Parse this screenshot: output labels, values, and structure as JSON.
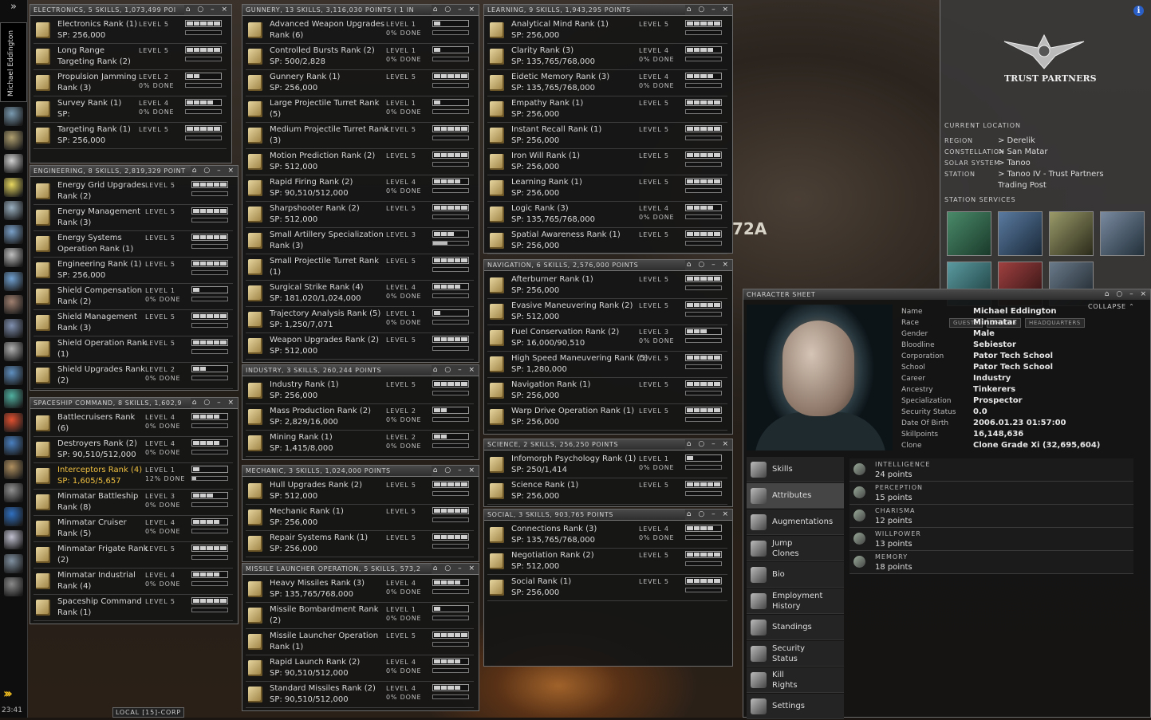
{
  "neocom": {
    "expand_label": "»",
    "character_name": "Michael Eddington",
    "clock": "23:41",
    "icons": [
      "portrait-icon",
      "character-icon",
      "mail-icon",
      "notepad-icon",
      "map-icon",
      "inventory-icon",
      "market-icon",
      "corp-icon",
      "fitting-icon",
      "science-icon",
      "assets-icon",
      "contracts-icon",
      "wallet-icon",
      "help-icon",
      "browser-icon",
      "journal-icon",
      "chat-icon",
      "info-icon",
      "agent-icon",
      "ship-icon",
      "drone-icon"
    ]
  },
  "background": {
    "hangar_text": "72A"
  },
  "windows": [
    {
      "id": "electronics",
      "title": "ELECTRONICS, 5 SKILLS, 1,073,499 POI",
      "controls": "⌂ ○ – ×",
      "skills": [
        {
          "n1": "Electronics Rank (1)",
          "n2": "SP: 256,000",
          "level": "LEVEL 5",
          "done": "",
          "lvl": 5,
          "train": 0
        },
        {
          "n1": "Long Range",
          "n2": "Targeting Rank (2)",
          "level": "LEVEL 5",
          "done": "",
          "lvl": 5,
          "train": 0
        },
        {
          "n1": "Propulsion Jamming",
          "n2": "Rank (3)",
          "level": "LEVEL 2",
          "done": "0% DONE",
          "lvl": 2,
          "train": 0
        },
        {
          "n1": "Survey Rank (1)",
          "n2": "SP:",
          "level": "LEVEL 4",
          "done": "0% DONE",
          "lvl": 4,
          "train": 0
        },
        {
          "n1": "Targeting Rank (1)",
          "n2": "SP: 256,000",
          "level": "LEVEL 5",
          "done": "",
          "lvl": 5,
          "train": 0
        }
      ]
    },
    {
      "id": "engineering",
      "title": "ENGINEERING, 8 SKILLS, 2,819,329 POINT",
      "controls": "⌂ ○ – ×",
      "skills": [
        {
          "n1": "Energy Grid Upgrades",
          "n2": "Rank (2)",
          "level": "LEVEL 5",
          "done": "",
          "lvl": 5,
          "train": 0
        },
        {
          "n1": "Energy Management",
          "n2": "Rank (3)",
          "level": "LEVEL 5",
          "done": "",
          "lvl": 5,
          "train": 0
        },
        {
          "n1": "Energy Systems",
          "n2": "Operation Rank (1)",
          "level": "LEVEL 5",
          "done": "",
          "lvl": 5,
          "train": 0
        },
        {
          "n1": "Engineering Rank (1)",
          "n2": "SP: 256,000",
          "level": "LEVEL 5",
          "done": "",
          "lvl": 5,
          "train": 0
        },
        {
          "n1": "Shield Compensation",
          "n2": "Rank (2)",
          "level": "LEVEL 1",
          "done": "0% DONE",
          "lvl": 1,
          "train": 0
        },
        {
          "n1": "Shield Management",
          "n2": "Rank (3)",
          "level": "LEVEL 5",
          "done": "",
          "lvl": 5,
          "train": 0
        },
        {
          "n1": "Shield Operation Rank",
          "n2": "(1)",
          "level": "LEVEL 5",
          "done": "",
          "lvl": 5,
          "train": 0
        },
        {
          "n1": "Shield Upgrades Rank",
          "n2": "(2)",
          "level": "LEVEL 2",
          "done": "0% DONE",
          "lvl": 2,
          "train": 0
        }
      ]
    },
    {
      "id": "spaceship",
      "title": "SPACESHIP COMMAND, 8 SKILLS, 1,602,9",
      "controls": "⌂ ○ – ×",
      "skills": [
        {
          "n1": "Battlecruisers Rank",
          "n2": "(6)",
          "level": "LEVEL 4",
          "done": "0% DONE",
          "lvl": 4,
          "train": 0
        },
        {
          "n1": "Destroyers Rank (2)",
          "n2": "SP: 90,510/512,000",
          "level": "LEVEL 4",
          "done": "0% DONE",
          "lvl": 4,
          "train": 0
        },
        {
          "n1": "Interceptors Rank (4)",
          "n2": "SP: 1,605/5,657",
          "level": "LEVEL 1",
          "done": "12% DONE",
          "lvl": 1,
          "train": 12,
          "highlight": true
        },
        {
          "n1": "Minmatar Battleship",
          "n2": "Rank (8)",
          "level": "LEVEL 3",
          "done": "0% DONE",
          "lvl": 3,
          "train": 0
        },
        {
          "n1": "Minmatar Cruiser",
          "n2": "Rank (5)",
          "level": "LEVEL 4",
          "done": "0% DONE",
          "lvl": 4,
          "train": 0
        },
        {
          "n1": "Minmatar Frigate Rank",
          "n2": "(2)",
          "level": "LEVEL 5",
          "done": "",
          "lvl": 5,
          "train": 0
        },
        {
          "n1": "Minmatar Industrial",
          "n2": "Rank (4)",
          "level": "LEVEL 4",
          "done": "0% DONE",
          "lvl": 4,
          "train": 0
        },
        {
          "n1": "Spaceship Command",
          "n2": "Rank (1)",
          "level": "LEVEL 5",
          "done": "",
          "lvl": 5,
          "train": 0
        }
      ]
    },
    {
      "id": "gunnery",
      "title": "GUNNERY, 13 SKILLS, 3,116,030 POINTS ( 1 IN",
      "controls": "⌂ ○ – ×",
      "skills": [
        {
          "n1": "Advanced Weapon Upgrades",
          "n2": "Rank (6)",
          "level": "LEVEL 1",
          "done": "0% DONE",
          "lvl": 1,
          "train": 0
        },
        {
          "n1": "Controlled Bursts Rank (2)",
          "n2": "SP: 500/2,828",
          "level": "LEVEL 1",
          "done": "0% DONE",
          "lvl": 1,
          "train": 0
        },
        {
          "n1": "Gunnery Rank (1)",
          "n2": "SP: 256,000",
          "level": "LEVEL 5",
          "done": "",
          "lvl": 5,
          "train": 0
        },
        {
          "n1": "Large Projectile Turret Rank",
          "n2": "(5)",
          "level": "LEVEL 1",
          "done": "0% DONE",
          "lvl": 1,
          "train": 0
        },
        {
          "n1": "Medium Projectile Turret Rank",
          "n2": "(3)",
          "level": "LEVEL 5",
          "done": "",
          "lvl": 5,
          "train": 0
        },
        {
          "n1": "Motion Prediction Rank (2)",
          "n2": "SP: 512,000",
          "level": "LEVEL 5",
          "done": "",
          "lvl": 5,
          "train": 0
        },
        {
          "n1": "Rapid Firing Rank (2)",
          "n2": "SP: 90,510/512,000",
          "level": "LEVEL 4",
          "done": "0% DONE",
          "lvl": 4,
          "train": 0
        },
        {
          "n1": "Sharpshooter Rank (2)",
          "n2": "SP: 512,000",
          "level": "LEVEL 5",
          "done": "",
          "lvl": 5,
          "train": 0
        },
        {
          "n1": "Small Artillery Specialization",
          "n2": "Rank (3)",
          "level": "LEVEL 3",
          "done": "",
          "lvl": 3,
          "train": 40
        },
        {
          "n1": "Small Projectile Turret Rank",
          "n2": "(1)",
          "level": "LEVEL 5",
          "done": "",
          "lvl": 5,
          "train": 0
        },
        {
          "n1": "Surgical Strike Rank (4)",
          "n2": "SP: 181,020/1,024,000",
          "level": "LEVEL 4",
          "done": "0% DONE",
          "lvl": 4,
          "train": 0
        },
        {
          "n1": "Trajectory Analysis Rank (5)",
          "n2": "SP: 1,250/7,071",
          "level": "LEVEL 1",
          "done": "0% DONE",
          "lvl": 1,
          "train": 0
        },
        {
          "n1": "Weapon Upgrades Rank (2)",
          "n2": "SP: 512,000",
          "level": "LEVEL 5",
          "done": "",
          "lvl": 5,
          "train": 0
        }
      ]
    },
    {
      "id": "industry",
      "title": "INDUSTRY, 3 SKILLS, 260,244 POINTS",
      "controls": "⌂ ○ – ×",
      "skills": [
        {
          "n1": "Industry Rank (1)",
          "n2": "SP: 256,000",
          "level": "LEVEL 5",
          "done": "",
          "lvl": 5,
          "train": 0
        },
        {
          "n1": "Mass Production Rank (2)",
          "n2": "SP: 2,829/16,000",
          "level": "LEVEL 2",
          "done": "0% DONE",
          "lvl": 2,
          "train": 0
        },
        {
          "n1": "Mining Rank (1)",
          "n2": "SP: 1,415/8,000",
          "level": "LEVEL 2",
          "done": "0% DONE",
          "lvl": 2,
          "train": 0
        }
      ]
    },
    {
      "id": "mechanic",
      "title": "MECHANIC, 3 SKILLS, 1,024,000 POINTS",
      "controls": "⌂ ○ – ×",
      "skills": [
        {
          "n1": "Hull Upgrades Rank (2)",
          "n2": "SP: 512,000",
          "level": "LEVEL 5",
          "done": "",
          "lvl": 5,
          "train": 0
        },
        {
          "n1": "Mechanic Rank (1)",
          "n2": "SP: 256,000",
          "level": "LEVEL 5",
          "done": "",
          "lvl": 5,
          "train": 0
        },
        {
          "n1": "Repair Systems Rank (1)",
          "n2": "SP: 256,000",
          "level": "LEVEL 5",
          "done": "",
          "lvl": 5,
          "train": 0
        }
      ]
    },
    {
      "id": "missile",
      "title": "MISSILE LAUNCHER OPERATION, 5 SKILLS, 573,2",
      "controls": "⌂ ○ – ×",
      "skills": [
        {
          "n1": "Heavy Missiles Rank (3)",
          "n2": "SP: 135,765/768,000",
          "level": "LEVEL 4",
          "done": "0% DONE",
          "lvl": 4,
          "train": 0
        },
        {
          "n1": "Missile Bombardment Rank",
          "n2": "(2)",
          "level": "LEVEL 1",
          "done": "0% DONE",
          "lvl": 1,
          "train": 0
        },
        {
          "n1": "Missile Launcher Operation",
          "n2": "Rank (1)",
          "level": "LEVEL 5",
          "done": "",
          "lvl": 5,
          "train": 0
        },
        {
          "n1": "Rapid Launch Rank (2)",
          "n2": "SP: 90,510/512,000",
          "level": "LEVEL 4",
          "done": "0% DONE",
          "lvl": 4,
          "train": 0
        },
        {
          "n1": "Standard Missiles Rank (2)",
          "n2": "SP: 90,510/512,000",
          "level": "LEVEL 4",
          "done": "0% DONE",
          "lvl": 4,
          "train": 0
        }
      ]
    },
    {
      "id": "learning",
      "title": "LEARNING, 9 SKILLS, 1,943,295 POINTS",
      "controls": "⌂ ○ – ×",
      "skills": [
        {
          "n1": "Analytical Mind Rank (1)",
          "n2": "SP: 256,000",
          "level": "LEVEL 5",
          "done": "",
          "lvl": 5,
          "train": 0
        },
        {
          "n1": "Clarity Rank (3)",
          "n2": "SP: 135,765/768,000",
          "level": "LEVEL 4",
          "done": "0% DONE",
          "lvl": 4,
          "train": 0
        },
        {
          "n1": "Eidetic Memory Rank (3)",
          "n2": "SP: 135,765/768,000",
          "level": "LEVEL 4",
          "done": "0% DONE",
          "lvl": 4,
          "train": 0
        },
        {
          "n1": "Empathy Rank (1)",
          "n2": "SP: 256,000",
          "level": "LEVEL 5",
          "done": "",
          "lvl": 5,
          "train": 0
        },
        {
          "n1": "Instant Recall Rank (1)",
          "n2": "SP: 256,000",
          "level": "LEVEL 5",
          "done": "",
          "lvl": 5,
          "train": 0
        },
        {
          "n1": "Iron Will Rank (1)",
          "n2": "SP: 256,000",
          "level": "LEVEL 5",
          "done": "",
          "lvl": 5,
          "train": 0
        },
        {
          "n1": "Learning Rank (1)",
          "n2": "SP: 256,000",
          "level": "LEVEL 5",
          "done": "",
          "lvl": 5,
          "train": 0
        },
        {
          "n1": "Logic Rank (3)",
          "n2": "SP: 135,765/768,000",
          "level": "LEVEL 4",
          "done": "0% DONE",
          "lvl": 4,
          "train": 0
        },
        {
          "n1": "Spatial Awareness Rank (1)",
          "n2": "SP: 256,000",
          "level": "LEVEL 5",
          "done": "",
          "lvl": 5,
          "train": 0
        }
      ]
    },
    {
      "id": "navigation",
      "title": "NAVIGATION, 6 SKILLS, 2,576,000 POINTS",
      "controls": "⌂ ○ – ×",
      "skills": [
        {
          "n1": "Afterburner Rank (1)",
          "n2": "SP: 256,000",
          "level": "LEVEL 5",
          "done": "",
          "lvl": 5,
          "train": 0
        },
        {
          "n1": "Evasive Maneuvering Rank (2)",
          "n2": "SP: 512,000",
          "level": "LEVEL 5",
          "done": "",
          "lvl": 5,
          "train": 0
        },
        {
          "n1": "Fuel Conservation Rank (2)",
          "n2": "SP: 16,000/90,510",
          "level": "LEVEL 3",
          "done": "0% DONE",
          "lvl": 3,
          "train": 0
        },
        {
          "n1": "High Speed Maneuvering Rank (5)",
          "n2": "SP: 1,280,000",
          "level": "LEVEL 5",
          "done": "",
          "lvl": 5,
          "train": 0
        },
        {
          "n1": "Navigation Rank (1)",
          "n2": "SP: 256,000",
          "level": "LEVEL 5",
          "done": "",
          "lvl": 5,
          "train": 0
        },
        {
          "n1": "Warp Drive Operation Rank (1)",
          "n2": "SP: 256,000",
          "level": "LEVEL 5",
          "done": "",
          "lvl": 5,
          "train": 0
        }
      ]
    },
    {
      "id": "science",
      "title": "SCIENCE, 2 SKILLS, 256,250 POINTS",
      "controls": "⌂ ○ – ×",
      "skills": [
        {
          "n1": "Infomorph Psychology Rank (1)",
          "n2": "SP: 250/1,414",
          "level": "LEVEL 1",
          "done": "0% DONE",
          "lvl": 1,
          "train": 0
        },
        {
          "n1": "Science Rank (1)",
          "n2": "SP: 256,000",
          "level": "LEVEL 5",
          "done": "",
          "lvl": 5,
          "train": 0
        }
      ]
    },
    {
      "id": "social",
      "title": "SOCIAL, 3 SKILLS, 903,765 POINTS",
      "controls": "⌂ ○ – ×",
      "skills": [
        {
          "n1": "Connections Rank (3)",
          "n2": "SP: 135,765/768,000",
          "level": "LEVEL 4",
          "done": "0% DONE",
          "lvl": 4,
          "train": 0
        },
        {
          "n1": "Negotiation Rank (2)",
          "n2": "SP: 512,000",
          "level": "LEVEL 5",
          "done": "",
          "lvl": 5,
          "train": 0
        },
        {
          "n1": "Social Rank (1)",
          "n2": "SP: 256,000",
          "level": "LEVEL 5",
          "done": "",
          "lvl": 5,
          "train": 0
        }
      ]
    }
  ],
  "station": {
    "corp_name": "TRUST PARTNERS",
    "current_location_label": "CURRENT LOCATION",
    "location": [
      {
        "k": "REGION",
        "v": "> Derelik"
      },
      {
        "k": "CONSTELLATION",
        "v": "> San Matar"
      },
      {
        "k": "SOLAR SYSTEM",
        "v": "> Tanoo"
      },
      {
        "k": "STATION",
        "v": "> Tanoo IV - Trust Partners"
      },
      {
        "k": "",
        "v": "Trading Post"
      }
    ],
    "services_label": "STATION SERVICES",
    "services": [
      "medical-icon",
      "repair-icon",
      "reprocessing-icon",
      "market-service-icon",
      "fitting-service-icon",
      "insurance-icon",
      "factory-icon"
    ]
  },
  "character_sheet": {
    "title": "CHARACTER SHEET",
    "controls": "⌂ ○ – ×",
    "collapse": "COLLAPSE ⌃",
    "tabs": [
      "GUESTS",
      "OFFICES",
      "HEADQUARTERS"
    ],
    "fields": [
      {
        "k": "Name",
        "v": "Michael Eddington"
      },
      {
        "k": "Race",
        "v": "Minmatar"
      },
      {
        "k": "Gender",
        "v": "Male"
      },
      {
        "k": "Bloodline",
        "v": "Sebiestor"
      },
      {
        "k": "Corporation",
        "v": "Pator Tech School"
      },
      {
        "k": "School",
        "v": "Pator Tech School"
      },
      {
        "k": "Career",
        "v": "Industry"
      },
      {
        "k": "Ancestry",
        "v": "Tinkerers"
      },
      {
        "k": "Specialization",
        "v": "Prospector"
      },
      {
        "k": "Security Status",
        "v": "0.0"
      },
      {
        "k": "Date Of Birth",
        "v": "2006.01.23 01:57:00"
      },
      {
        "k": "Skillpoints",
        "v": "16,148,636"
      },
      {
        "k": "Clone",
        "v": "Clone Grade Xi (32,695,604)"
      }
    ],
    "nav": [
      {
        "label": "Skills",
        "icon": "skills-icon"
      },
      {
        "label": "Attributes",
        "icon": "attributes-icon",
        "selected": true
      },
      {
        "label": "Augmentations",
        "icon": "augmentations-icon"
      },
      {
        "label": "Jump\nClones",
        "icon": "jump-clones-icon"
      },
      {
        "label": "Bio",
        "icon": "bio-icon"
      },
      {
        "label": "Employment\nHistory",
        "icon": "employment-icon"
      },
      {
        "label": "Standings",
        "icon": "standings-icon"
      },
      {
        "label": "Security\nStatus",
        "icon": "security-icon"
      },
      {
        "label": "Kill\nRights",
        "icon": "kill-rights-icon"
      },
      {
        "label": "Settings",
        "icon": "settings-icon"
      }
    ],
    "attributes": [
      {
        "name": "INTELLIGENCE",
        "points": "24 points"
      },
      {
        "name": "PERCEPTION",
        "points": "15 points"
      },
      {
        "name": "CHARISMA",
        "points": "12 points"
      },
      {
        "name": "WILLPOWER",
        "points": "13 points"
      },
      {
        "name": "MEMORY",
        "points": "18 points"
      }
    ]
  },
  "chat_tab": "LOCAL [15]-CORP"
}
